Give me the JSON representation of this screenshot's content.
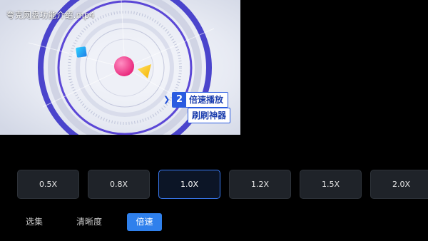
{
  "video": {
    "title": "夸克网盘功能介绍.mp4",
    "promo": {
      "number": "2",
      "line1": "倍速播放",
      "line2": "刷刷神器"
    }
  },
  "speed_options": [
    "0.5X",
    "0.8X",
    "1.0X",
    "1.2X",
    "1.5X",
    "2.0X"
  ],
  "selected_speed": "1.0X",
  "tabs": [
    {
      "label": "选集"
    },
    {
      "label": "清晰度"
    },
    {
      "label": "倍速"
    }
  ],
  "active_tab": "倍速",
  "colors": {
    "accent": "#2f80ec",
    "selected_border": "#3a7bf5",
    "button_bg": "#1f2329",
    "background": "#000000"
  }
}
